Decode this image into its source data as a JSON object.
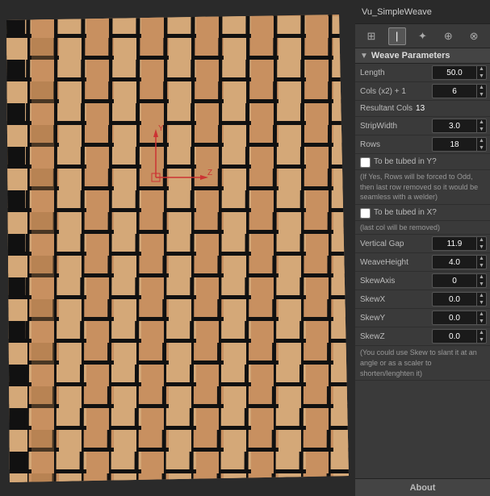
{
  "panel": {
    "title": "Vu_SimpleWeave",
    "toolbar": {
      "icons": [
        "⊞",
        "⚓",
        "✦",
        "⊕",
        "⊗"
      ]
    },
    "section_title": "Weave Parameters",
    "params": {
      "length_label": "Length",
      "length_value": "50.0",
      "cols_label": "Cols (x2) + 1",
      "cols_value": "6",
      "resultant_label": "Resultant Cols",
      "resultant_value": "13",
      "stripwidth_label": "StripWidth",
      "stripwidth_value": "3.0",
      "rows_label": "Rows",
      "rows_value": "18",
      "tube_y_label": "To be tubed in Y?",
      "tube_y_info": "(If Yes, Rows will be forced to Odd, then last row removed so it would be seamless with a welder)",
      "tube_x_label": "To be tubed in X?",
      "tube_x_info": "(last col will be removed)",
      "vertical_gap_label": "Vertical Gap",
      "vertical_gap_value": "11.9",
      "weave_height_label": "WeaveHeight",
      "weave_height_value": "4.0",
      "skew_axis_label": "SkewAxis",
      "skew_axis_value": "0",
      "skew_x_label": "SkewX",
      "skew_x_value": "0.0",
      "skew_y_label": "SkewY",
      "skew_y_value": "0.0",
      "skew_z_label": "SkewZ",
      "skew_z_value": "0.0",
      "skew_info": "(You could use Skew to slant it at an angle or as a scaler to shorten/lenghten it)"
    },
    "about_label": "About"
  }
}
